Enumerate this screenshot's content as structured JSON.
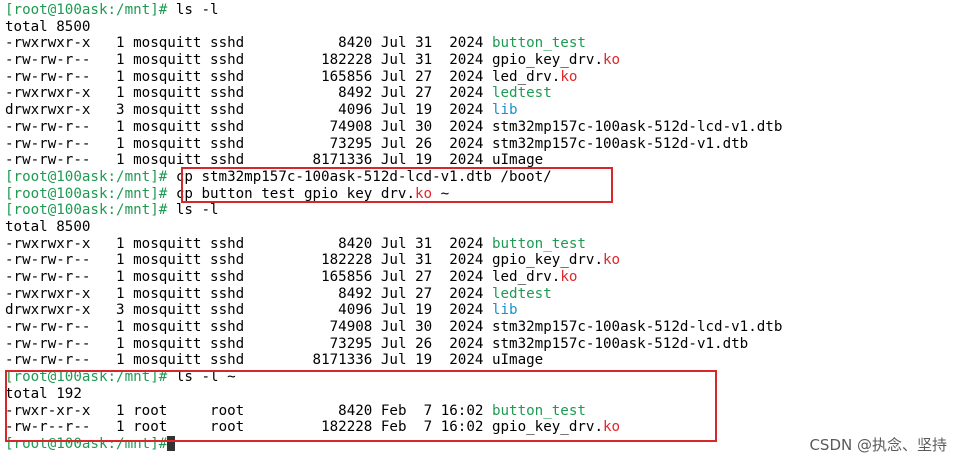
{
  "terminal": {
    "blocks": [
      {
        "prompt": "[root@100ask:/mnt]#",
        "command": " ls -l",
        "total": "total 8500",
        "files": [
          {
            "perms": "-rwxrwxr-x",
            "links": "1",
            "owner": "mosquitt",
            "group": "sshd",
            "size": "8420",
            "month": "Jul",
            "day": "31",
            "year": "2024",
            "base": "button_test",
            "ext": "",
            "kind": "exe"
          },
          {
            "perms": "-rw-rw-r--",
            "links": "1",
            "owner": "mosquitt",
            "group": "sshd",
            "size": "182228",
            "month": "Jul",
            "day": "31",
            "year": "2024",
            "base": "gpio_key_drv.",
            "ext": "ko",
            "kind": "ko"
          },
          {
            "perms": "-rw-rw-r--",
            "links": "1",
            "owner": "mosquitt",
            "group": "sshd",
            "size": "165856",
            "month": "Jul",
            "day": "27",
            "year": "2024",
            "base": "led_drv.",
            "ext": "ko",
            "kind": "ko"
          },
          {
            "perms": "-rwxrwxr-x",
            "links": "1",
            "owner": "mosquitt",
            "group": "sshd",
            "size": "8492",
            "month": "Jul",
            "day": "27",
            "year": "2024",
            "base": "ledtest",
            "ext": "",
            "kind": "exe"
          },
          {
            "perms": "drwxrwxr-x",
            "links": "3",
            "owner": "mosquitt",
            "group": "sshd",
            "size": "4096",
            "month": "Jul",
            "day": "19",
            "year": "2024",
            "base": "lib",
            "ext": "",
            "kind": "dir"
          },
          {
            "perms": "-rw-rw-r--",
            "links": "1",
            "owner": "mosquitt",
            "group": "sshd",
            "size": "74908",
            "month": "Jul",
            "day": "30",
            "year": "2024",
            "base": "stm32mp157c-100ask-512d-lcd-v1.dtb",
            "ext": "",
            "kind": "plain"
          },
          {
            "perms": "-rw-rw-r--",
            "links": "1",
            "owner": "mosquitt",
            "group": "sshd",
            "size": "73295",
            "month": "Jul",
            "day": "26",
            "year": "2024",
            "base": "stm32mp157c-100ask-512d-v1.dtb",
            "ext": "",
            "kind": "plain"
          },
          {
            "perms": "-rw-rw-r--",
            "links": "1",
            "owner": "mosquitt",
            "group": "sshd",
            "size": "8171336",
            "month": "Jul",
            "day": "19",
            "year": "2024",
            "base": "uImage",
            "ext": "",
            "kind": "plain"
          }
        ]
      },
      {
        "prompt": "[root@100ask:/mnt]#",
        "command": " cp stm32mp157c-100ask-512d-lcd-v1.dtb /boot/",
        "files": []
      },
      {
        "prompt": "[root@100ask:/mnt]#",
        "command": " cp button_test gpio_key_drv.",
        "command_ext": "ko",
        "command_tail": " ~",
        "files": []
      },
      {
        "prompt": "[root@100ask:/mnt]#",
        "command": " ls -l",
        "total": "total 8500",
        "files": [
          {
            "perms": "-rwxrwxr-x",
            "links": "1",
            "owner": "mosquitt",
            "group": "sshd",
            "size": "8420",
            "month": "Jul",
            "day": "31",
            "year": "2024",
            "base": "button_test",
            "ext": "",
            "kind": "exe"
          },
          {
            "perms": "-rw-rw-r--",
            "links": "1",
            "owner": "mosquitt",
            "group": "sshd",
            "size": "182228",
            "month": "Jul",
            "day": "31",
            "year": "2024",
            "base": "gpio_key_drv.",
            "ext": "ko",
            "kind": "ko"
          },
          {
            "perms": "-rw-rw-r--",
            "links": "1",
            "owner": "mosquitt",
            "group": "sshd",
            "size": "165856",
            "month": "Jul",
            "day": "27",
            "year": "2024",
            "base": "led_drv.",
            "ext": "ko",
            "kind": "ko"
          },
          {
            "perms": "-rwxrwxr-x",
            "links": "1",
            "owner": "mosquitt",
            "group": "sshd",
            "size": "8492",
            "month": "Jul",
            "day": "27",
            "year": "2024",
            "base": "ledtest",
            "ext": "",
            "kind": "exe"
          },
          {
            "perms": "drwxrwxr-x",
            "links": "3",
            "owner": "mosquitt",
            "group": "sshd",
            "size": "4096",
            "month": "Jul",
            "day": "19",
            "year": "2024",
            "base": "lib",
            "ext": "",
            "kind": "dir"
          },
          {
            "perms": "-rw-rw-r--",
            "links": "1",
            "owner": "mosquitt",
            "group": "sshd",
            "size": "74908",
            "month": "Jul",
            "day": "30",
            "year": "2024",
            "base": "stm32mp157c-100ask-512d-lcd-v1.dtb",
            "ext": "",
            "kind": "plain"
          },
          {
            "perms": "-rw-rw-r--",
            "links": "1",
            "owner": "mosquitt",
            "group": "sshd",
            "size": "73295",
            "month": "Jul",
            "day": "26",
            "year": "2024",
            "base": "stm32mp157c-100ask-512d-v1.dtb",
            "ext": "",
            "kind": "plain"
          },
          {
            "perms": "-rw-rw-r--",
            "links": "1",
            "owner": "mosquitt",
            "group": "sshd",
            "size": "8171336",
            "month": "Jul",
            "day": "19",
            "year": "2024",
            "base": "uImage",
            "ext": "",
            "kind": "plain"
          }
        ]
      },
      {
        "prompt": "[root@100ask:/mnt]#",
        "command": " ls -l ~",
        "total": "total 192",
        "files": [
          {
            "perms": "-rwxr-xr-x",
            "links": "1",
            "owner": "root",
            "group": "root",
            "size": "8420",
            "month": "Feb",
            "day": "7",
            "year": "16:02",
            "base": "button_test",
            "ext": "",
            "kind": "exe"
          },
          {
            "perms": "-rw-r--r--",
            "links": "1",
            "owner": "root",
            "group": "root",
            "size": "182228",
            "month": "Feb",
            "day": "7",
            "year": "16:02",
            "base": "gpio_key_drv.",
            "ext": "ko",
            "kind": "ko"
          }
        ]
      },
      {
        "prompt": "[root@100ask:/mnt]#",
        "command": "",
        "cursor": true,
        "files": []
      }
    ]
  },
  "watermark": "CSDN @执念、坚持",
  "colors": {
    "prompt": "#1e9a52",
    "executable": "#1e9a52",
    "ko_ext": "#e0262c",
    "directory": "#1a8fd0",
    "highlight_box": "#d9262b"
  }
}
